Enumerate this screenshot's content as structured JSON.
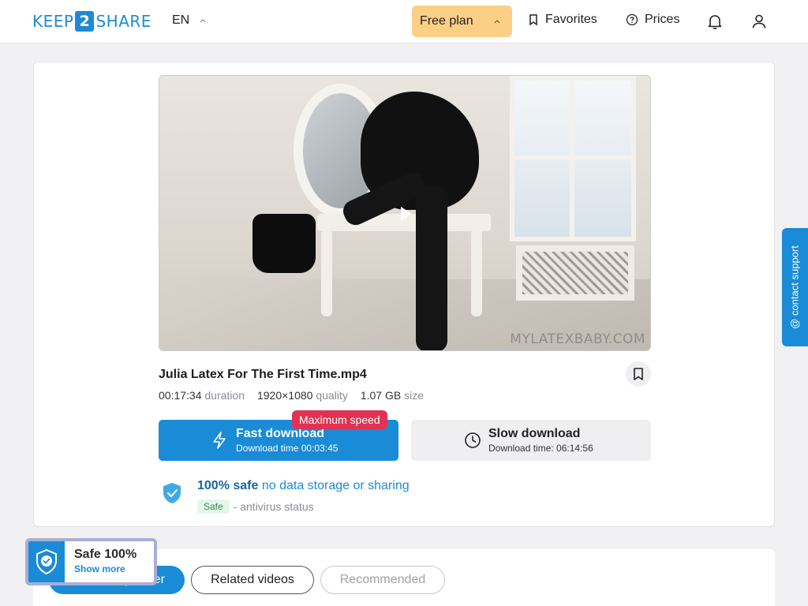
{
  "header": {
    "logo_left": "KEEP",
    "logo_num": "2",
    "logo_right": "SHARE",
    "language": "EN",
    "plan_label": "Free plan",
    "favorites_label": "Favorites",
    "prices_label": "Prices"
  },
  "file": {
    "watermark": "MYLATEXBABY.COM",
    "title": "Julia Latex For The First Time.mp4",
    "duration_value": "00:17:34",
    "duration_label": "duration",
    "quality_value": "1920×1080",
    "quality_label": "quality",
    "size_value": "1.07 GB",
    "size_label": "size"
  },
  "download": {
    "fast_title": "Fast download",
    "fast_sub": "Download time 00:03:45",
    "badge": "Maximum speed",
    "slow_title": "Slow download",
    "slow_sub": "Download time: 06:14:56"
  },
  "safety": {
    "headline_bold": "100% safe",
    "headline_rest": "no data storage or sharing",
    "status_pill": "Safe",
    "status_text": "- antivirus status"
  },
  "tabs": [
    {
      "label": "From this partner",
      "active": true
    },
    {
      "label": "Related videos",
      "active": false
    },
    {
      "label": "Recommended",
      "active": false
    }
  ],
  "widget": {
    "title": "Safe 100%",
    "link": "Show more"
  },
  "support": {
    "label": "@ contact support"
  },
  "colors": {
    "brand_blue": "#1a8bd6",
    "plan_yellow": "#fccf86",
    "badge_red": "#e03252",
    "safe_green": "#2d8f4c"
  },
  "icons": [
    "bookmark-icon",
    "help-circle-icon",
    "bell-icon",
    "user-icon",
    "lightning-icon",
    "clock-icon",
    "shield-check-icon",
    "play-icon",
    "chevron-up-icon"
  ]
}
